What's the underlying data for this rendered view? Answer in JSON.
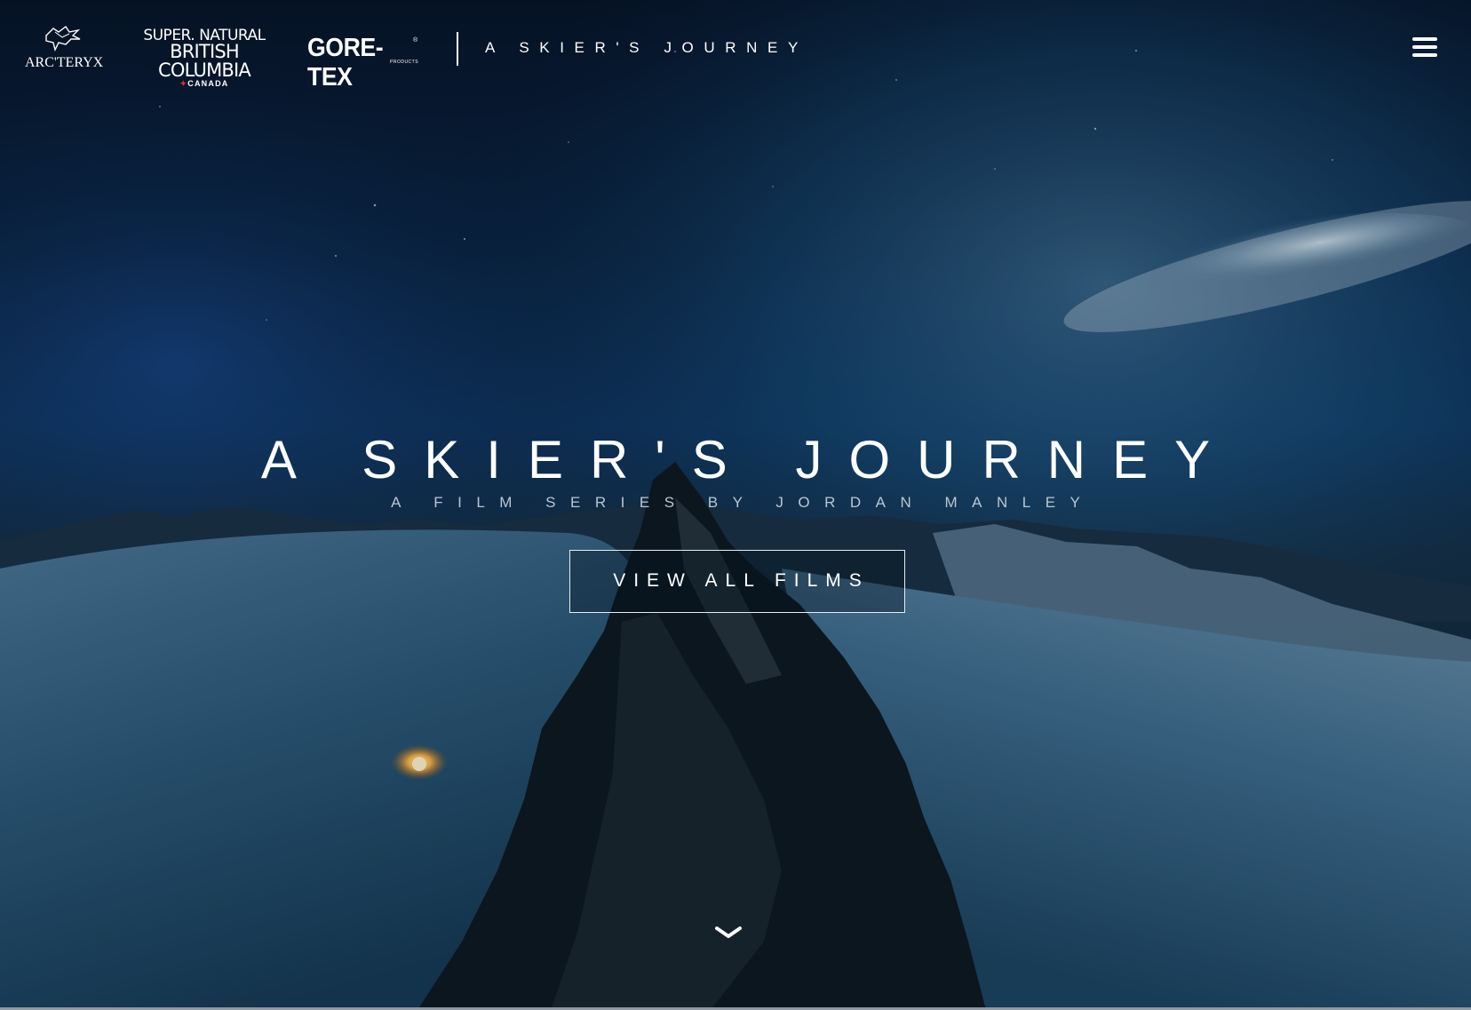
{
  "header": {
    "logos": {
      "arcteryx": "ARC'TERYX",
      "bc_line1": "SUPER. NATURAL",
      "bc_line2": "BRITISH COLUMBIA",
      "bc_line3": "CANADA",
      "goretex": "GORE-TEX",
      "goretex_sub": "PRODUCTS",
      "goretex_mark": "®"
    },
    "site_title": "A SKIER'S JOURNEY",
    "menu_icon": "hamburger-menu-icon"
  },
  "hero": {
    "title": "A SKIER'S JOURNEY",
    "subtitle": "A FILM SERIES BY JORDAN MANLEY",
    "cta_label": "VIEW ALL FILMS",
    "scroll_icon": "chevron-down-icon"
  },
  "colors": {
    "text": "#ffffff",
    "subtitle": "#b9c6d4",
    "sky_deep": "#0b1f3c",
    "aurora_blue": "#1b5e8a",
    "snow": "#3c6d90"
  }
}
